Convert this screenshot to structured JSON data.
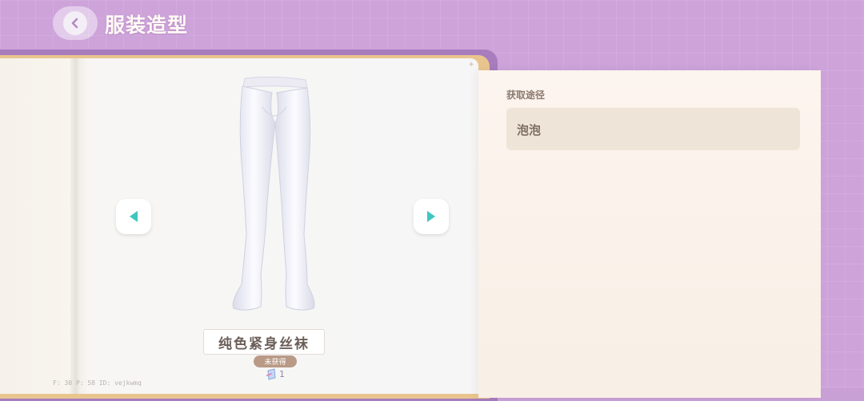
{
  "header": {
    "title": "服装造型"
  },
  "item": {
    "name": "纯色紧身丝袜",
    "status": "未获得",
    "count": "1"
  },
  "source": {
    "label": "获取途径",
    "value": "泡泡"
  },
  "debug": {
    "text": "F: 30    P: 58    ID: vejkwmq"
  },
  "icons": {
    "back": "chevron-left-icon",
    "prev": "triangle-left-icon",
    "next": "triangle-right-icon",
    "count": "item-token-icon"
  },
  "colors": {
    "background": "#cda3da",
    "arrow_accent": "#3ec7c0",
    "badge": "#b99a86"
  }
}
